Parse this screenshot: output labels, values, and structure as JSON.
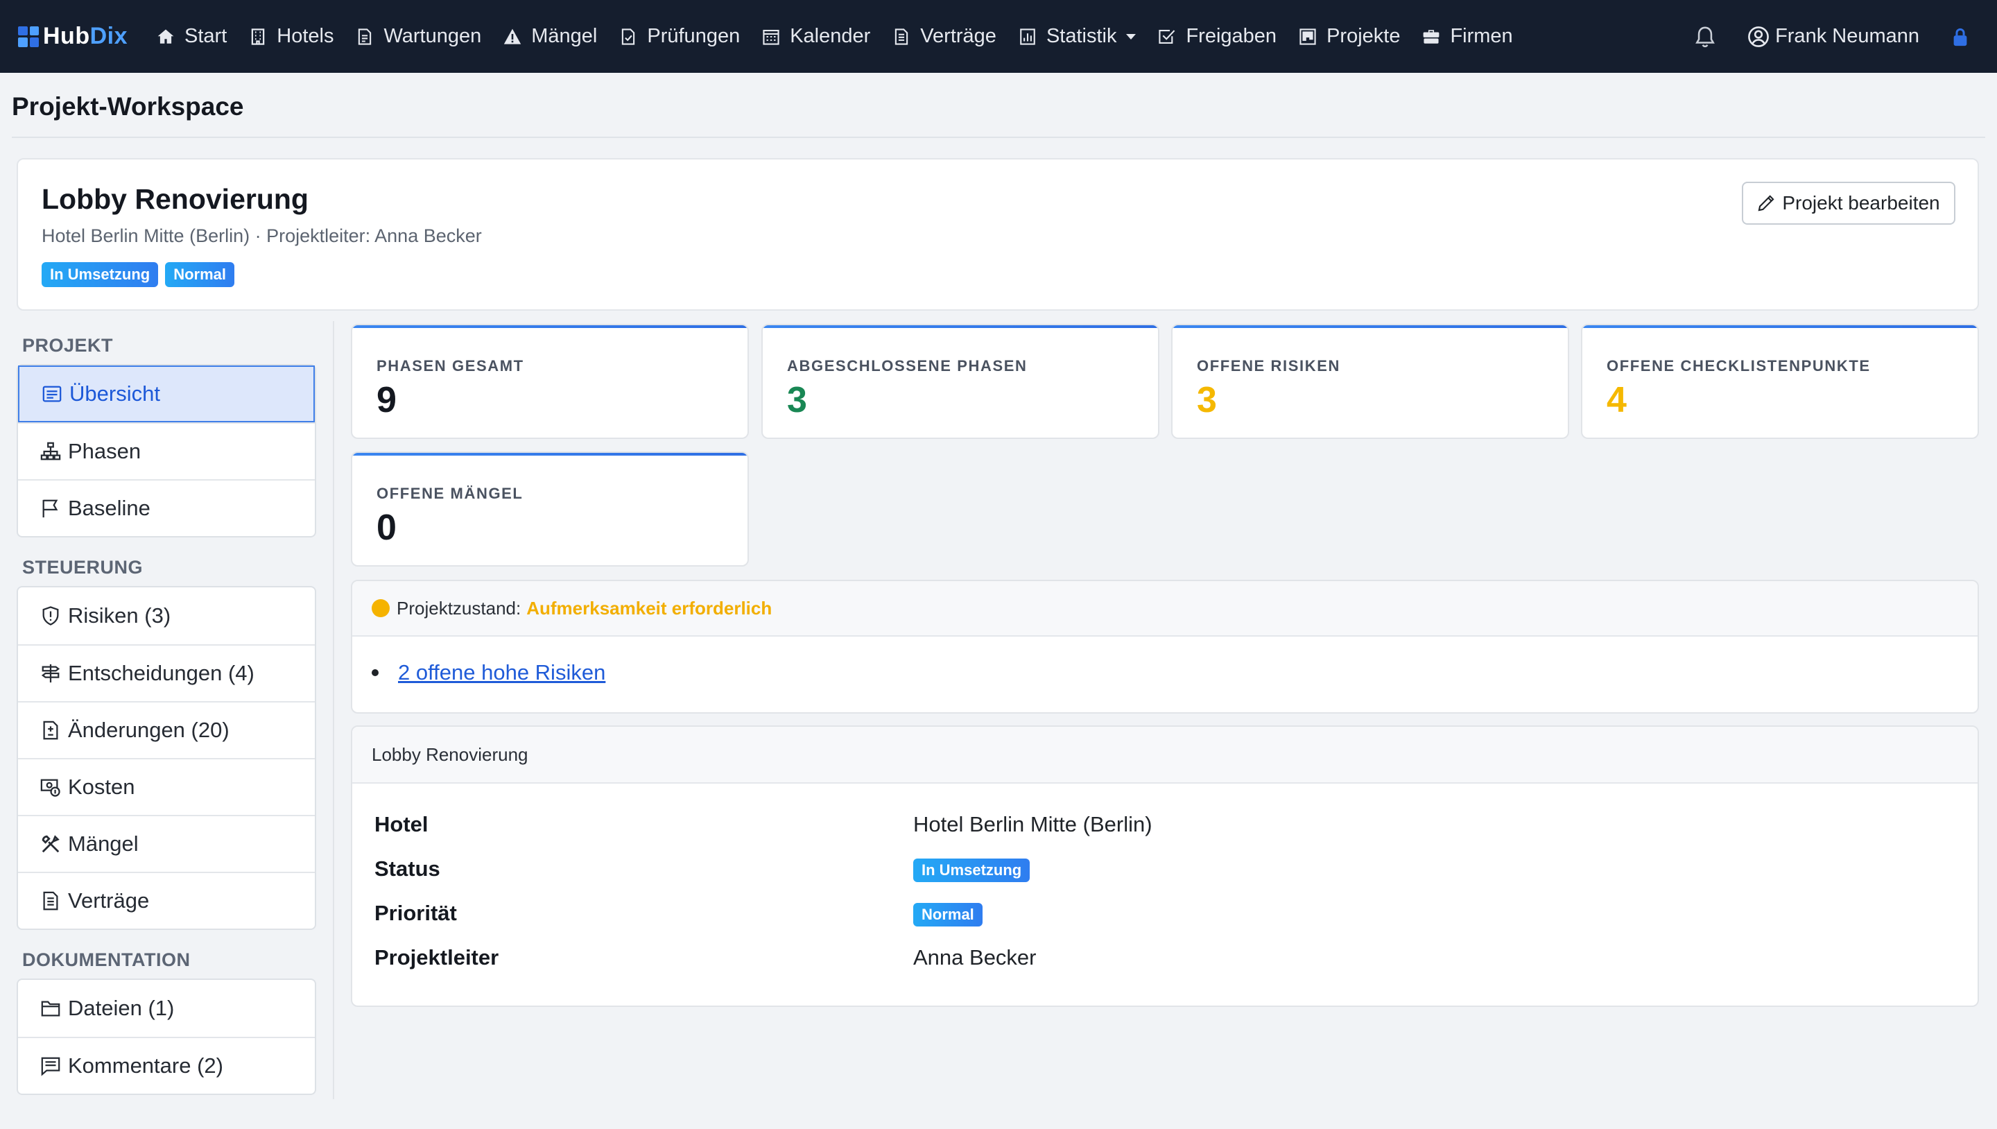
{
  "navbar": {
    "brand_a": "Hub",
    "brand_b": "Dix",
    "items": [
      {
        "label": "Start",
        "icon": "house-icon"
      },
      {
        "label": "Hotels",
        "icon": "building-icon"
      },
      {
        "label": "Wartungen",
        "icon": "document-icon"
      },
      {
        "label": "Mängel",
        "icon": "warning-icon"
      },
      {
        "label": "Prüfungen",
        "icon": "file-check-icon"
      },
      {
        "label": "Kalender",
        "icon": "calendar-icon"
      },
      {
        "label": "Verträge",
        "icon": "contract-icon"
      },
      {
        "label": "Statistik",
        "icon": "chart-icon"
      },
      {
        "label": "Freigaben",
        "icon": "checkbox-icon"
      },
      {
        "label": "Projekte",
        "icon": "kanban-icon"
      },
      {
        "label": "Firmen",
        "icon": "briefcase-icon"
      }
    ],
    "user_name": "Frank Neumann"
  },
  "page": {
    "title": "Projekt-Workspace"
  },
  "project": {
    "name": "Lobby Renovierung",
    "subtitle": "Hotel Berlin Mitte (Berlin) · Projektleiter: Anna Becker",
    "status_badge": "In Umsetzung",
    "priority_badge": "Normal",
    "edit_label": "Projekt bearbeiten"
  },
  "sidebar": {
    "sections": [
      {
        "title": "PROJEKT",
        "items": [
          {
            "label": "Übersicht",
            "icon": "list-icon",
            "active": true
          },
          {
            "label": "Phasen",
            "icon": "diagram-icon"
          },
          {
            "label": "Baseline",
            "icon": "flag-icon"
          }
        ]
      },
      {
        "title": "STEUERUNG",
        "items": [
          {
            "label": "Risiken (3)",
            "icon": "shield-icon"
          },
          {
            "label": "Entscheidungen (4)",
            "icon": "signpost-icon"
          },
          {
            "label": "Änderungen (20)",
            "icon": "file-diff-icon"
          },
          {
            "label": "Kosten",
            "icon": "cash-icon"
          },
          {
            "label": "Mängel",
            "icon": "tools-icon"
          },
          {
            "label": "Verträge",
            "icon": "contract-icon"
          }
        ]
      },
      {
        "title": "DOKUMENTATION",
        "items": [
          {
            "label": "Dateien (1)",
            "icon": "folder-icon"
          },
          {
            "label": "Kommentare (2)",
            "icon": "comment-icon"
          }
        ]
      }
    ]
  },
  "stats": [
    {
      "label": "PHASEN GESAMT",
      "value": "9",
      "color": "#141820"
    },
    {
      "label": "ABGESCHLOSSENE PHASEN",
      "value": "3",
      "color": "#198754"
    },
    {
      "label": "OFFENE RISIKEN",
      "value": "3",
      "color": "#f5b800"
    },
    {
      "label": "OFFENE CHECKLISTENPUNKTE",
      "value": "4",
      "color": "#f5b800"
    },
    {
      "label": "OFFENE MÄNGEL",
      "value": "0",
      "color": "#141820"
    }
  ],
  "health": {
    "label": "Projektzustand:",
    "status": "Aufmerksamkeit erforderlich",
    "items": [
      "2 offene hohe Risiken"
    ]
  },
  "details": {
    "title": "Lobby Renovierung",
    "rows": [
      {
        "key": "Hotel",
        "value": "Hotel Berlin Mitte (Berlin)"
      },
      {
        "key": "Status",
        "value": "In Umsetzung"
      },
      {
        "key": "Priorität",
        "value": "Normal"
      },
      {
        "key": "Projektleiter",
        "value": "Anna Becker"
      }
    ]
  }
}
